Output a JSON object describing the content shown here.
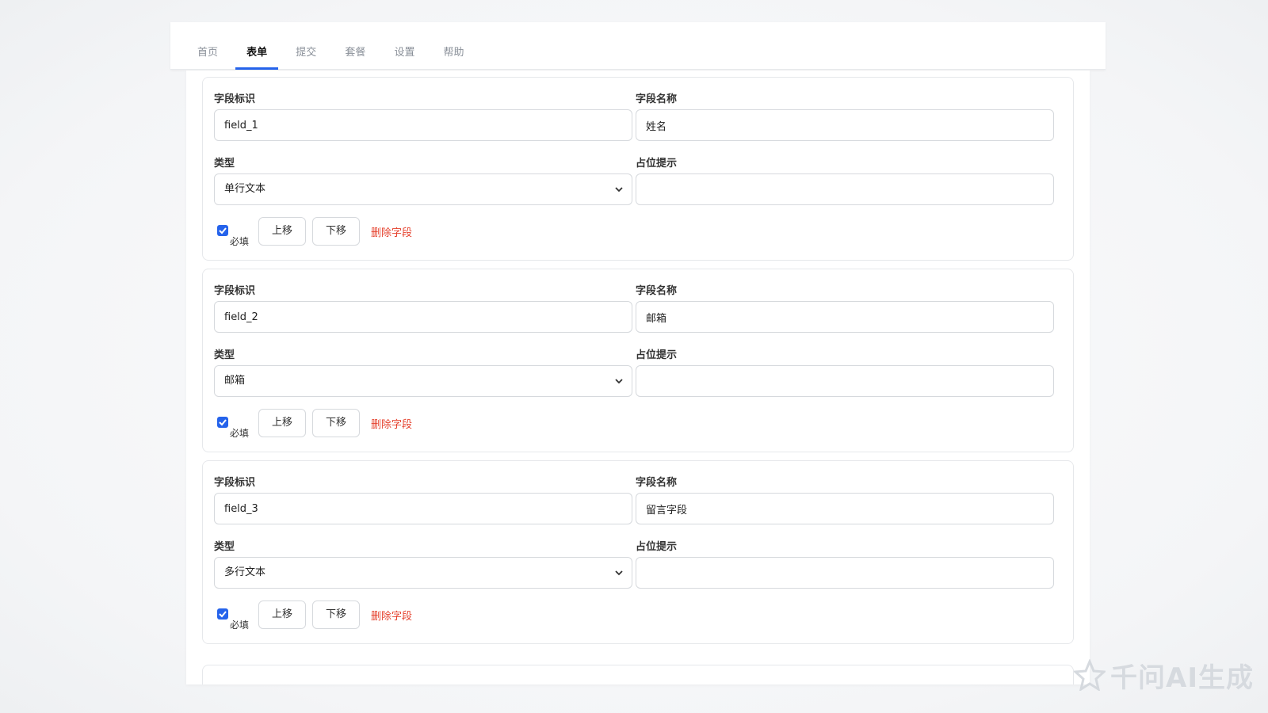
{
  "tabs": [
    {
      "label": "首页",
      "active": false
    },
    {
      "label": "表单",
      "active": true
    },
    {
      "label": "提交",
      "active": false
    },
    {
      "label": "套餐",
      "active": false
    },
    {
      "label": "设置",
      "active": false
    },
    {
      "label": "帮助",
      "active": false
    }
  ],
  "labels": {
    "field_id": "字段标识",
    "field_name": "字段名称",
    "type": "类型",
    "placeholder": "占位提示",
    "required": "必填",
    "move_up": "上移",
    "move_down": "下移",
    "delete": "删除字段"
  },
  "fields": [
    {
      "id": "field_1",
      "name": "姓名",
      "type": "单行文本",
      "placeholder": "",
      "required": true
    },
    {
      "id": "field_2",
      "name": "邮箱",
      "type": "邮箱",
      "placeholder": "",
      "required": true
    },
    {
      "id": "field_3",
      "name": "留言字段",
      "type": "多行文本",
      "placeholder": "",
      "required": true
    }
  ],
  "watermark": "千问AI生成",
  "colors": {
    "accent": "#2563eb",
    "danger": "#e5412d",
    "border": "#d6d9dd"
  }
}
